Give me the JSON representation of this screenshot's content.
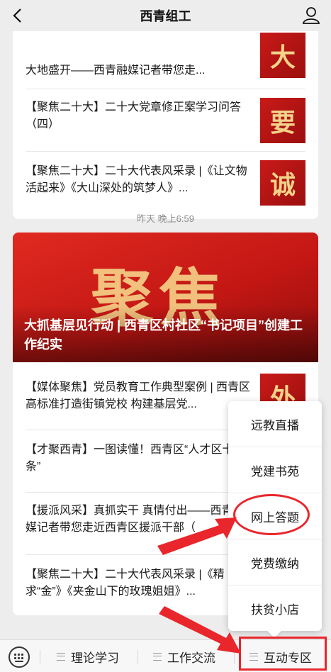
{
  "topbar": {
    "title": "西青组工"
  },
  "feed": {
    "group1": {
      "items": [
        {
          "title": "大地盛开——西青融媒记者带您走...",
          "thumb_char": "大"
        },
        {
          "title": "【聚焦二十大】二十大党章修正案学习问答（四）",
          "thumb_char": "要"
        },
        {
          "title": "【聚焦二十大】二十大代表风采录 |《让文物活起来》《大山深处的筑梦人》...",
          "thumb_char": "诚"
        }
      ]
    },
    "timestamp": "昨天 晚上6:59",
    "group2": {
      "cover_text": "聚焦",
      "headline": "大抓基层见行动 | 西青区村社区“书记项目”创建工作纪实",
      "items": [
        {
          "title": "【媒体聚焦】党员教育工作典型案例 | 西青区高标准打造街镇党校 构建基层党...",
          "thumb_char": "外"
        },
        {
          "title": "【才聚西青】一图读懂！西青区“人才区十五条”"
        },
        {
          "title": "【援派风采】真抓实干 真情付出——西青融媒记者带您走近西青区援派干部（"
        },
        {
          "title": "【聚焦二十大】二十大代表风采录 |《精求“金”》《夹金山下的玫瑰姐姐》..."
        }
      ]
    }
  },
  "popup_menu": {
    "items": [
      "远教直播",
      "党建书苑",
      "网上答题",
      "党费缴纳",
      "扶贫小店"
    ]
  },
  "bottom_menu": {
    "tabs": [
      "理论学习",
      "工作交流",
      "互动专区"
    ]
  },
  "colors": {
    "annotation": "#e8262b",
    "cover_red": "#c41714",
    "cover_gold": "#f5cf86"
  }
}
